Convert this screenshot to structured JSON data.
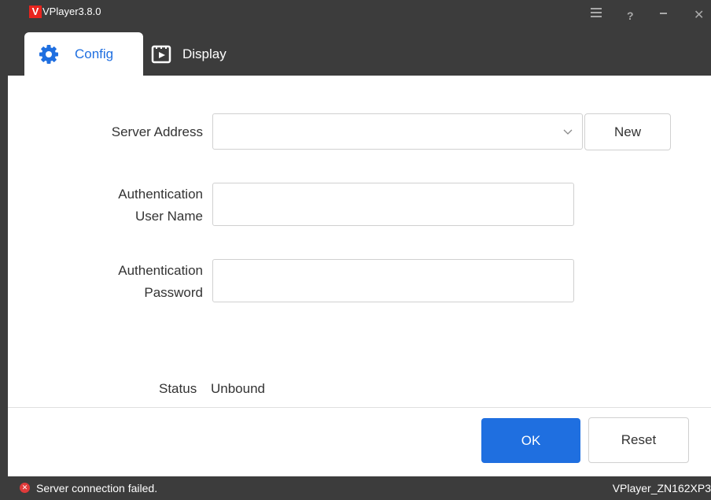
{
  "app": {
    "logo_letter": "V",
    "title": "VPlayer3.8.0"
  },
  "window_controls": {
    "help": "?",
    "close": "✕"
  },
  "tabs": [
    {
      "label": "Config",
      "icon": "gear-icon",
      "active": true
    },
    {
      "label": "Display",
      "icon": "display-icon",
      "active": false
    }
  ],
  "form": {
    "server_address": {
      "label": "Server Address",
      "value": "",
      "placeholder": ""
    },
    "new_button": "New",
    "username": {
      "label_line1": "Authentication",
      "label_line2": "User Name",
      "value": ""
    },
    "password": {
      "label_line1": "Authentication",
      "label_line2": "Password",
      "value": ""
    },
    "status_label": "Status",
    "status_value": "Unbound"
  },
  "actions": {
    "ok": "OK",
    "reset": "Reset"
  },
  "statusbar": {
    "error_glyph": "✕",
    "error_text": "Server connection failed.",
    "device_name": "VPlayer_ZN162XP3"
  },
  "colors": {
    "accent": "#1f6fe0",
    "titlebar": "#3c3c3c",
    "logo": "#e8241e",
    "error": "#e03a3a"
  }
}
